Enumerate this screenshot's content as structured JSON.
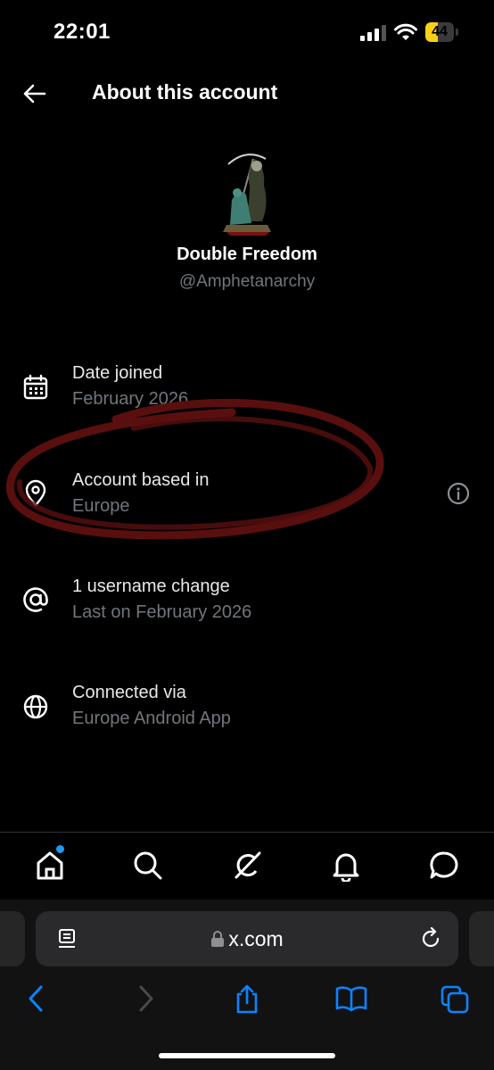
{
  "status_bar": {
    "time": "22:01",
    "battery": "44",
    "battery_level": 0.44,
    "battery_color": "#f7d117"
  },
  "header": {
    "title": "About this account"
  },
  "profile": {
    "name": "Double Freedom",
    "handle": "@Amphetanarchy"
  },
  "rows": [
    {
      "icon": "calendar-icon",
      "label": "Date joined",
      "value": "February 2026"
    },
    {
      "icon": "location-pin-icon",
      "label": "Account based in",
      "value": "Europe"
    },
    {
      "icon": "at-sign-icon",
      "label": "1 username change",
      "value": "Last on February 2026"
    },
    {
      "icon": "globe-icon",
      "label": "Connected via",
      "value": "Europe Android App"
    }
  ],
  "bottom_nav": [
    "home-icon",
    "search-icon",
    "grok-icon",
    "bell-icon",
    "messages-icon"
  ],
  "browser": {
    "url": "x.com"
  },
  "colors": {
    "accent": "#1d9bf0",
    "muted": "#71767b",
    "safari_blue": "#0a84ff",
    "annotation_red": "#5a0f0f"
  }
}
